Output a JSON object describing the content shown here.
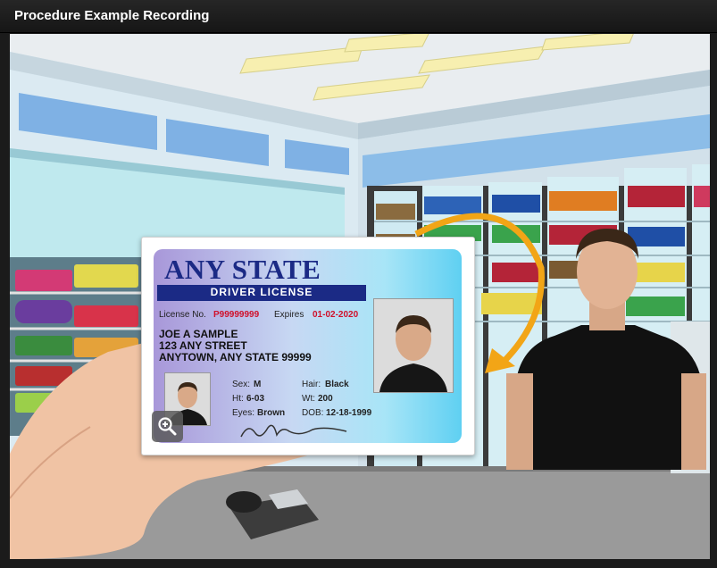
{
  "window": {
    "title": "Procedure Example Recording"
  },
  "id_card": {
    "state": "ANY STATE",
    "type": "DRIVER LICENSE",
    "license_label": "License No.",
    "license_number": "P99999999",
    "expires_label": "Expires",
    "expires_date": "01-02-2020",
    "name": "JOE A SAMPLE",
    "address_line1": "123 ANY STREET",
    "address_line2": "ANYTOWN, ANY STATE 99999",
    "sex_label": "Sex:",
    "sex_value": "M",
    "hair_label": "Hair:",
    "hair_value": "Black",
    "height_label": "Ht:",
    "height_value": "6-03",
    "weight_label": "Wt:",
    "weight_value": "200",
    "eyes_label": "Eyes:",
    "eyes_value": "Brown",
    "dob_label": "DOB:",
    "dob_value": "12-18-1999"
  },
  "icons": {
    "zoom": "zoom-in-icon"
  },
  "colors": {
    "title_bar": "#1b1b1b",
    "card_blue": "#1b2a85",
    "card_red": "#d0102a",
    "arrow_orange": "#f2a516"
  }
}
